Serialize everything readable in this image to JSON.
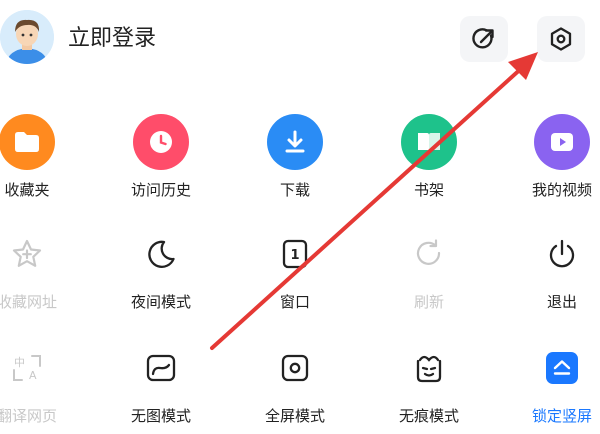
{
  "header": {
    "login_label": "立即登录"
  },
  "row1": [
    {
      "label": "收藏夹",
      "icon": "folder-icon",
      "color": "#ff8a1f"
    },
    {
      "label": "访问历史",
      "icon": "clock-icon",
      "color": "#ff4d6a"
    },
    {
      "label": "下载",
      "icon": "download-icon",
      "color": "#2a8cf5"
    },
    {
      "label": "书架",
      "icon": "book-icon",
      "color": "#1ec28b"
    },
    {
      "label": "我的视频",
      "icon": "play-icon",
      "color": "#8a63f0"
    }
  ],
  "row2": [
    {
      "label": "收藏网址",
      "icon": "star-add-icon",
      "state": "disabled"
    },
    {
      "label": "夜间模式",
      "icon": "moon-icon"
    },
    {
      "label": "窗口",
      "icon": "window-count-icon",
      "count": "1"
    },
    {
      "label": "刷新",
      "icon": "refresh-icon",
      "state": "disabled"
    },
    {
      "label": "退出",
      "icon": "power-icon"
    }
  ],
  "row3": [
    {
      "label": "翻译网页",
      "icon": "translate-icon",
      "state": "disabled"
    },
    {
      "label": "无图模式",
      "icon": "no-image-icon"
    },
    {
      "label": "全屏模式",
      "icon": "fullscreen-icon"
    },
    {
      "label": "无痕模式",
      "icon": "incognito-icon"
    },
    {
      "label": "锁定竖屏",
      "icon": "lock-portrait-icon",
      "state": "active",
      "color": "#1a78ff"
    }
  ],
  "annotation_color": "#e53935"
}
